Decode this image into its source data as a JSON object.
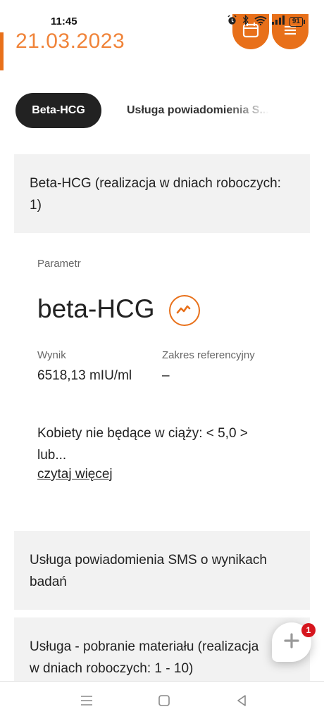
{
  "status_bar": {
    "time": "11:45",
    "battery": "91",
    "icons": [
      "alarm-icon",
      "bluetooth-icon",
      "wifi-icon",
      "signal-icon",
      "battery-icon"
    ]
  },
  "header": {
    "date": "21.03.2023",
    "accent_color": "#e8701a",
    "buttons": [
      "calendar-icon",
      "menu-icon"
    ]
  },
  "tabs": [
    {
      "label": "Beta-HCG",
      "active": true
    },
    {
      "label": "Usługa powiadomienia S...",
      "active": false
    }
  ],
  "sections": {
    "beta_title": "Beta-HCG (realizacja w dniach roboczych: 1)",
    "sms_title": "Usługa powiadomienia SMS o wynikach badań",
    "sampling_title": "Usługa - pobranie materiału (realizacja w dniach roboczych: 1 - 10)"
  },
  "result": {
    "param_label": "Parametr",
    "param_name": "beta-HCG",
    "trend_icon": "trend-chart-icon",
    "value_label": "Wynik",
    "value": "6518,13 mIU/ml",
    "reference_label": "Zakres referencyjny",
    "reference_value": "–",
    "description": "Kobiety nie będące w ciąży: < 5,0 > lub...",
    "read_more": "czytaj więcej"
  },
  "chat": {
    "badge_count": "1",
    "icon": "plus-icon"
  },
  "nav_bar": [
    "menu-icon",
    "home-square-icon",
    "back-triangle-icon"
  ]
}
